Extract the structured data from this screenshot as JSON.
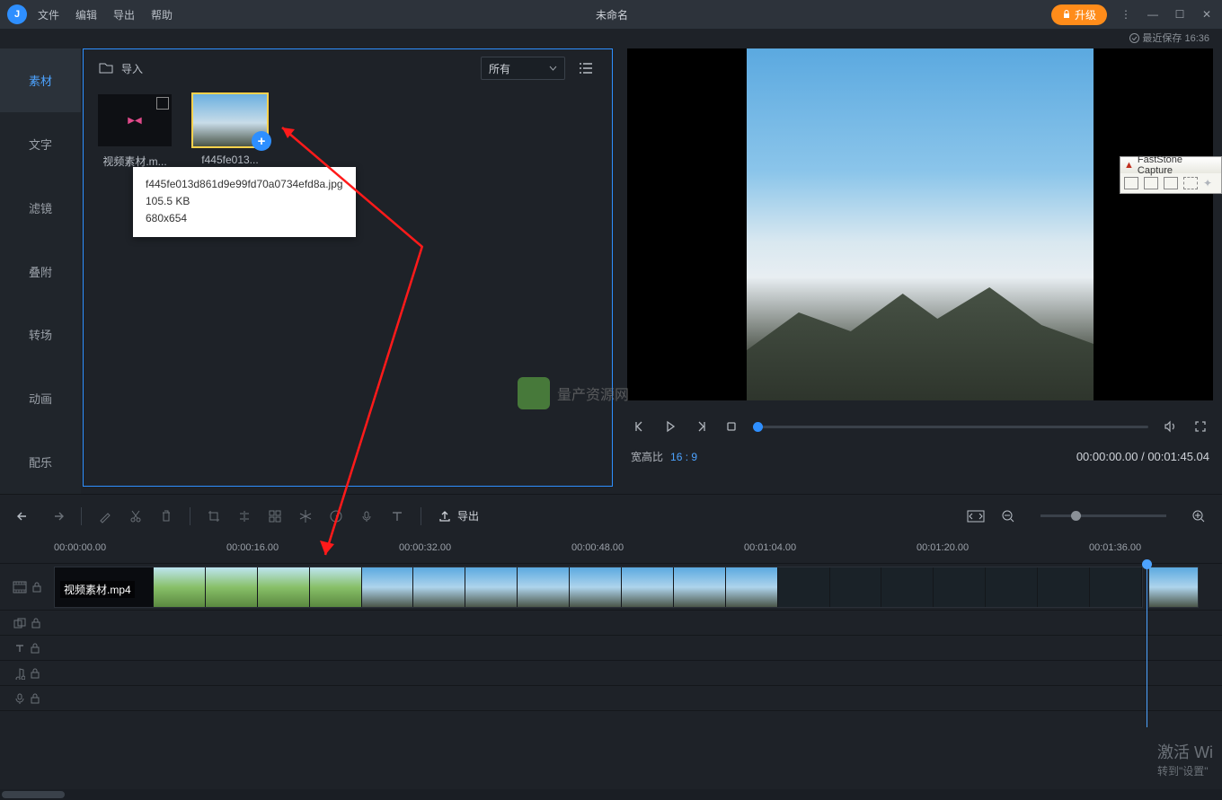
{
  "titlebar": {
    "menus": [
      "文件",
      "编辑",
      "导出",
      "帮助"
    ],
    "title": "未命名",
    "upgrade": "升级"
  },
  "save_row": {
    "label": "最近保存",
    "time": "16:36"
  },
  "sidebar": {
    "items": [
      "素材",
      "文字",
      "滤镜",
      "叠附",
      "转场",
      "动画",
      "配乐"
    ]
  },
  "media": {
    "import": "导入",
    "filter": "所有",
    "thumbs": [
      {
        "label": "视频素材.m..."
      },
      {
        "label": "f445fe013..."
      }
    ],
    "tooltip": {
      "line1": "f445fe013d861d9e99fd70a0734efd8a.jpg",
      "line2": "105.5 KB",
      "line3": "680x654"
    }
  },
  "watermark": "量产资源网",
  "preview": {
    "aspect_label": "宽高比",
    "aspect_value": "16 : 9",
    "time": "00:00:00.00 / 00:01:45.04"
  },
  "toolbar": {
    "export": "导出"
  },
  "ruler": [
    "00:00:00.00",
    "00:00:16.00",
    "00:00:32.00",
    "00:00:48.00",
    "00:01:04.00",
    "00:01:20.00",
    "00:01:36.00"
  ],
  "clip": {
    "label": "视频素材.mp4"
  },
  "faststone": "FastStone Capture",
  "activate": {
    "line1": "激活 Wi",
    "line2": "转到\"设置\""
  }
}
